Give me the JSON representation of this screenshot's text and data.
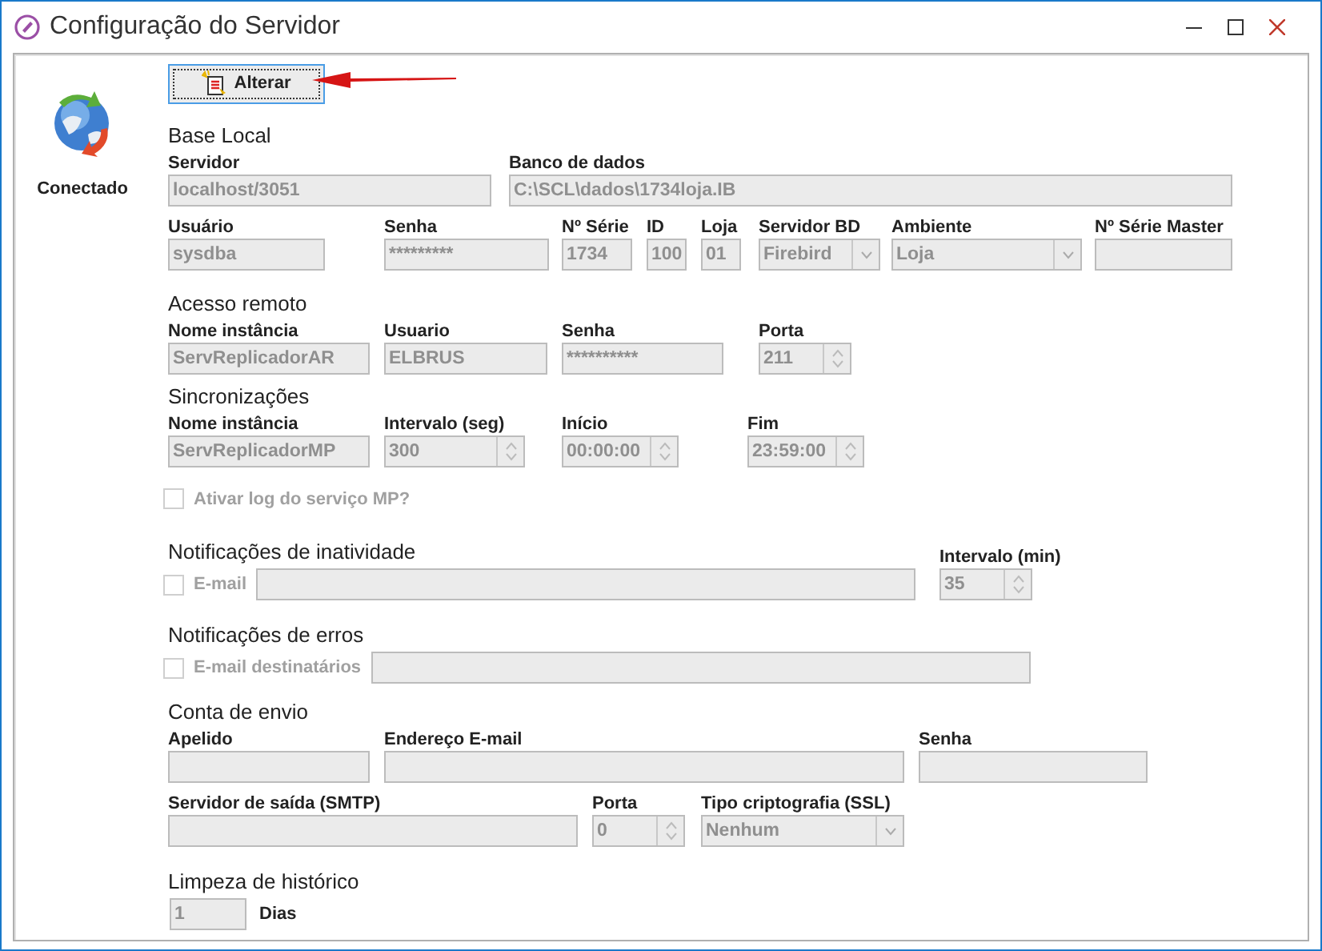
{
  "window": {
    "title": "Configuração do Servidor"
  },
  "status": {
    "label": "Conectado"
  },
  "edit_button": {
    "label": "Alterar"
  },
  "disabled": true,
  "sections": [
    {
      "title": "Base Local",
      "rows": [
        [
          {
            "kind": "text",
            "label": "Servidor",
            "value": "localhost/3051"
          },
          {
            "kind": "text",
            "label": "Banco de dados",
            "value": "C:\\SCL\\dados\\1734loja.IB"
          }
        ]
      ]
    },
    {
      "rows": [
        [
          {
            "kind": "text",
            "label": "Usuário",
            "value": "sysdba"
          },
          {
            "kind": "text",
            "label": "Senha",
            "value": "*********"
          },
          {
            "kind": "text",
            "label": "Nº Série",
            "value": "1734"
          },
          {
            "kind": "text",
            "label": "ID",
            "value": "100"
          },
          {
            "kind": "text",
            "label": "Loja",
            "value": "01"
          },
          {
            "kind": "combo",
            "label": "Servidor BD",
            "value": "Firebird"
          },
          {
            "kind": "combo",
            "label": "Ambiente",
            "value": "Loja"
          },
          {
            "kind": "text",
            "label": "Nº Série Master"
          }
        ]
      ]
    },
    {
      "title": "Acesso remoto",
      "rows": [
        [
          {
            "kind": "text",
            "label": "Nome instância",
            "value": "ServReplicadorAR"
          },
          {
            "kind": "text",
            "label": "Usuario",
            "value": "ELBRUS"
          },
          {
            "kind": "text",
            "label": "Senha",
            "value": "**********"
          },
          {
            "kind": "spin",
            "label": "Porta",
            "value": "211"
          }
        ]
      ]
    },
    {
      "title": "Sincronizações",
      "rows": [
        [
          {
            "kind": "text",
            "label": "Nome instância",
            "value": "ServReplicadorMP"
          },
          {
            "kind": "spin",
            "label": "Intervalo (seg)",
            "value": "300"
          },
          {
            "kind": "spin",
            "label": "Início",
            "value": "00:00:00"
          },
          {
            "kind": "spin",
            "label": "Fim",
            "value": "23:59:00"
          }
        ]
      ]
    },
    {
      "rows": [
        [
          {
            "kind": "checkbox",
            "label": "Ativar log do serviço MP?",
            "checked": false
          }
        ]
      ]
    },
    {
      "title": "Notificações de inatividade",
      "rows": [
        [
          {
            "kind": "check-field",
            "label": "E-mail",
            "checked": false
          },
          {
            "kind": "spin",
            "label": "Intervalo (min)",
            "value": "35"
          }
        ]
      ]
    },
    {
      "title": "Notificações de erros",
      "rows": [
        [
          {
            "kind": "check-field",
            "label": "E-mail destinatários",
            "checked": false
          }
        ]
      ]
    },
    {
      "title": "Conta de envio",
      "rows": [
        [
          {
            "kind": "text",
            "label": "Apelido"
          },
          {
            "kind": "text",
            "label": "Endereço E-mail"
          },
          {
            "kind": "text",
            "label": "Senha"
          }
        ],
        [
          {
            "kind": "text",
            "label": "Servidor de saída (SMTP)"
          },
          {
            "kind": "spin",
            "label": "Porta",
            "value": "0"
          },
          {
            "kind": "combo",
            "label": "Tipo criptografia (SSL)",
            "value": "Nenhum"
          }
        ]
      ]
    },
    {
      "title": "Limpeza de histórico",
      "rows": [
        [
          {
            "kind": "suffix",
            "value": "1",
            "suffix": "Dias"
          }
        ]
      ]
    }
  ]
}
